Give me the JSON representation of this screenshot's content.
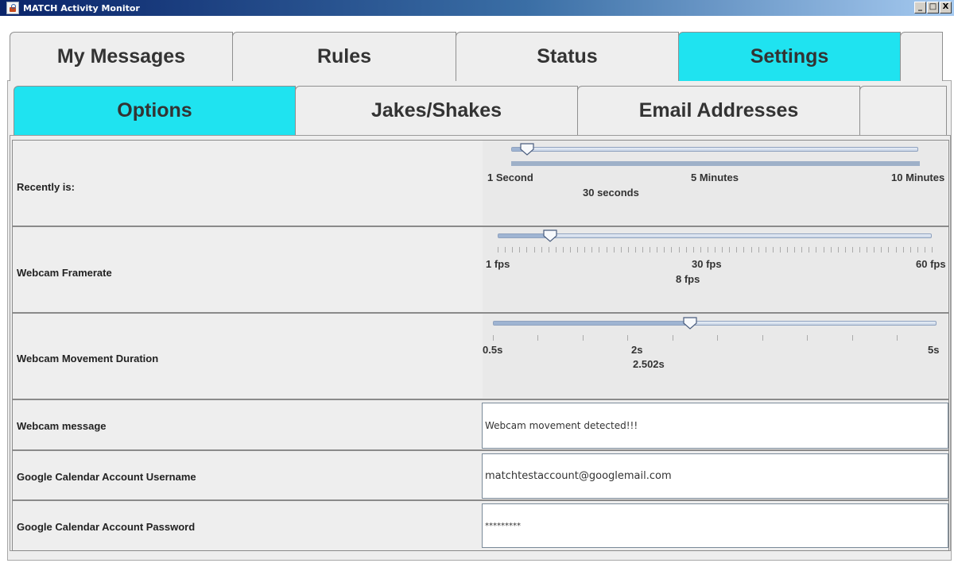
{
  "window": {
    "title": "MATCH Activity Monitor",
    "buttons": [
      "_",
      "□",
      "X"
    ]
  },
  "main_tabs": [
    {
      "label": "My Messages",
      "active": false
    },
    {
      "label": "Rules",
      "active": false
    },
    {
      "label": "Status",
      "active": false
    },
    {
      "label": "Settings",
      "active": true
    }
  ],
  "sub_tabs": [
    {
      "label": "Options",
      "active": true
    },
    {
      "label": "Jakes/Shakes",
      "active": false
    },
    {
      "label": "Email Addresses",
      "active": false
    }
  ],
  "options": {
    "recently": {
      "label": "Recently is:",
      "tick_labels": [
        "1 Second",
        "5 Minutes",
        "10 Minutes"
      ],
      "value": "30 seconds",
      "fraction": 0.04
    },
    "framerate": {
      "label": "Webcam Framerate",
      "tick_labels": [
        "1 fps",
        "30 fps",
        "60 fps"
      ],
      "value": "8 fps",
      "fraction": 0.12
    },
    "movement": {
      "label": "Webcam Movement Duration",
      "tick_labels": [
        "0.5s",
        "2s",
        "5s"
      ],
      "value": "2.502s",
      "fraction": 0.445
    },
    "webcam_message": {
      "label": "Webcam message",
      "value": "Webcam movement detected!!!"
    },
    "gcal_username": {
      "label": "Google Calendar Account Username",
      "value": "matchtestaccount@googlemail.com"
    },
    "gcal_password": {
      "label": "Google Calendar Account Password",
      "value": "*********"
    }
  },
  "colors": {
    "active_tab": "#1fe3f0",
    "panel_bg": "#eeeeee"
  }
}
